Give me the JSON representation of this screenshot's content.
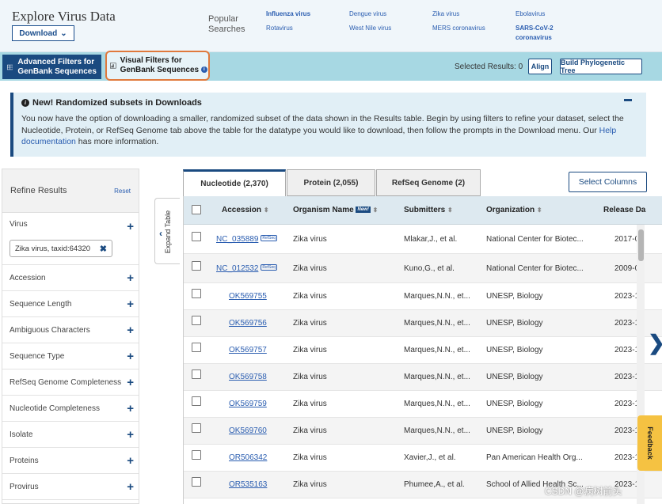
{
  "header": {
    "title": "Explore Virus Data",
    "download_label": "Download",
    "popular_label": "Popular Searches",
    "popular": [
      {
        "label": "Influenza virus",
        "bold": true
      },
      {
        "label": "Rotavirus",
        "bold": false
      },
      {
        "label": "Dengue virus",
        "bold": false
      },
      {
        "label": "West Nile virus",
        "bold": false
      },
      {
        "label": "Zika virus",
        "bold": false
      },
      {
        "label": "MERS coronavirus",
        "bold": false
      },
      {
        "label": "Ebolavirus",
        "bold": false
      },
      {
        "label": "SARS-CoV-2 coronavirus",
        "bold": true
      }
    ]
  },
  "filterbar": {
    "advanced_label": "Advanced Filters for GenBank Sequences",
    "visual_label": "Visual Filters for GenBank Sequences",
    "selected_results": "Selected Results: 0",
    "align_label": "Align",
    "build_label": "Build Phylogenetic Tree"
  },
  "notice": {
    "title": "New! Randomized subsets in Downloads",
    "body": "You now have the option of downloading a smaller, randomized subset of the data shown in the Results table. Begin by using filters to refine your dataset, select the Nucleotide, Protein, or RefSeq Genome tab above the table for the datatype you would like to download, then follow the prompts in the Download menu. Our ",
    "link": "Help documentation",
    "tail": " has more information."
  },
  "sidebar": {
    "title": "Refine Results",
    "reset": "Reset",
    "virus_label": "Virus",
    "virus_chip": "Zika virus, taxid:64320",
    "facets": [
      "Accession",
      "Sequence Length",
      "Ambiguous Characters",
      "Sequence Type",
      "RefSeq Genome Completeness",
      "Nucleotide Completeness",
      "Isolate",
      "Proteins",
      "Provirus"
    ]
  },
  "expand_label": "Expand Table",
  "tabs": [
    "Nucleotide (2,370)",
    "Protein (2,055)",
    "RefSeq Genome (2)"
  ],
  "select_columns": "Select Columns",
  "table": {
    "columns": [
      "Accession",
      "Organism Name",
      "Submitters",
      "Organization",
      "Release Da"
    ],
    "new_badge": "New!",
    "refseq_badge": "RefSeq",
    "rows": [
      {
        "accession": "NC_035889",
        "refseq": true,
        "organism": "Zika virus",
        "submitters": "Mlakar,J., et al.",
        "organization": "National Center for Biotec...",
        "release": "2017-0"
      },
      {
        "accession": "NC_012532",
        "refseq": true,
        "organism": "Zika virus",
        "submitters": "Kuno,G., et al.",
        "organization": "National Center for Biotec...",
        "release": "2009-0"
      },
      {
        "accession": "OK569755",
        "refseq": false,
        "organism": "Zika virus",
        "submitters": "Marques,N.N., et...",
        "organization": "UNESP, Biology",
        "release": "2023-1"
      },
      {
        "accession": "OK569756",
        "refseq": false,
        "organism": "Zika virus",
        "submitters": "Marques,N.N., et...",
        "organization": "UNESP, Biology",
        "release": "2023-1"
      },
      {
        "accession": "OK569757",
        "refseq": false,
        "organism": "Zika virus",
        "submitters": "Marques,N.N., et...",
        "organization": "UNESP, Biology",
        "release": "2023-1"
      },
      {
        "accession": "OK569758",
        "refseq": false,
        "organism": "Zika virus",
        "submitters": "Marques,N.N., et...",
        "organization": "UNESP, Biology",
        "release": "2023-1"
      },
      {
        "accession": "OK569759",
        "refseq": false,
        "organism": "Zika virus",
        "submitters": "Marques,N.N., et...",
        "organization": "UNESP, Biology",
        "release": "2023-1"
      },
      {
        "accession": "OK569760",
        "refseq": false,
        "organism": "Zika virus",
        "submitters": "Marques,N.N., et...",
        "organization": "UNESP, Biology",
        "release": "2023-1"
      },
      {
        "accession": "OR506342",
        "refseq": false,
        "organism": "Zika virus",
        "submitters": "Xavier,J., et al.",
        "organization": "Pan American Health Org...",
        "release": "2023-1"
      },
      {
        "accession": "OR535163",
        "refseq": false,
        "organism": "Zika virus",
        "submitters": "Phumee,A., et al.",
        "organization": "School of Allied Health Sc...",
        "release": "2023-1"
      }
    ]
  },
  "feedback_label": "Feedback",
  "watermark": "CSDN @病树前头"
}
